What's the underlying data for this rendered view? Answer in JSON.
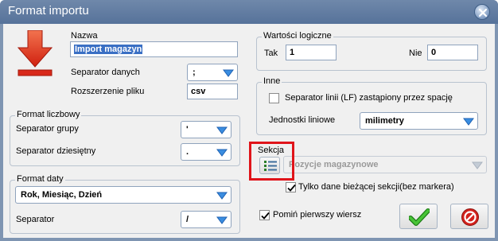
{
  "window": {
    "title": "Format importu"
  },
  "left": {
    "nazwa_label": "Nazwa",
    "nazwa_value": "Import magazyn",
    "separator_danych_label": "Separator danych",
    "separator_danych_value": ";",
    "rozszerzenie_label": "Rozszerzenie pliku",
    "rozszerzenie_value": "csv",
    "format_liczbowy": {
      "title": "Format liczbowy",
      "separator_grupy_label": "Separator grupy",
      "separator_grupy_value": "'",
      "separator_dziesietny_label": "Separator dziesiętny",
      "separator_dziesietny_value": "."
    },
    "format_daty": {
      "title": "Format daty",
      "format_value": "Rok, Miesiąc, Dzień",
      "separator_label": "Separator",
      "separator_value": "/"
    }
  },
  "right": {
    "wartosci_logiczne": {
      "title": "Wartości logiczne",
      "tak_label": "Tak",
      "tak_value": "1",
      "nie_label": "Nie",
      "nie_value": "0"
    },
    "inne": {
      "title": "Inne",
      "separator_linii_label": "Separator linii (LF) zastąpiony przez spację",
      "separator_linii_checked": false,
      "jednostki_label": "Jednostki liniowe",
      "jednostki_value": "milimetry"
    },
    "sekcja": {
      "label": "Sekcja",
      "value": "Pozycje magazynowe",
      "tylko_dane_label": "Tylko dane bieżącej sekcji(bez markera)",
      "tylko_dane_checked": true
    },
    "pomin_label": "Pomiń pierwszy wiersz",
    "pomin_checked": true
  },
  "icons": {
    "import": "import-arrow-icon",
    "close": "close-icon",
    "ok": "checkmark-icon",
    "cancel": "cancel-icon",
    "sekcja_list": "list-icon",
    "dropdown": "chevron-down-icon"
  },
  "colors": {
    "accent_blue": "#3a8de0",
    "import_arrow": "#e8321d",
    "highlight": "#e0141a",
    "ok_green": "#2fae23",
    "cancel_red": "#d3211c"
  }
}
